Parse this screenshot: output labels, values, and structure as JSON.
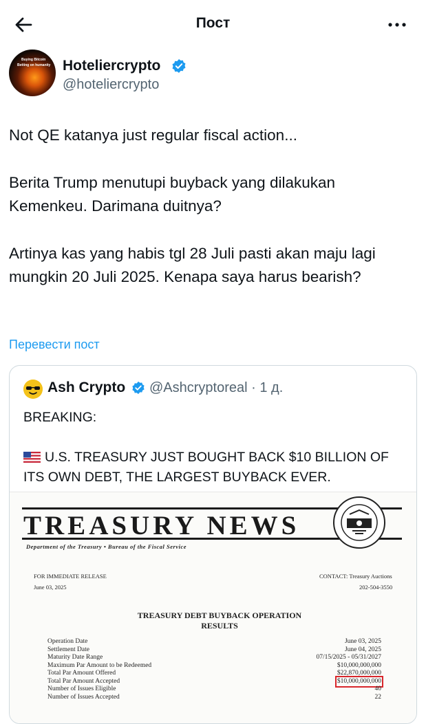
{
  "header": {
    "title": "Пост",
    "back_icon": "arrow-left-icon",
    "more_icon": "more-horizontal-icon"
  },
  "author": {
    "name": "Hoteliercrypto",
    "handle": "@hoteliercrypto",
    "avatar_text_1": "Buying Bitcoin",
    "avatar_text_2": "Betting on humanity"
  },
  "post": {
    "paragraphs": [
      "Not QE katanya just regular fiscal action...",
      "Berita Trump menutupi buyback yang dilakukan Kemenkeu. Darimana duitnya?",
      "Artinya kas yang habis tgl 28 Juli pasti akan maju lagi mungkin 20 Juli 2025. Kenapa saya harus bearish?"
    ],
    "translate_label": "Перевести пост"
  },
  "quote": {
    "name": "Ash Crypto",
    "handle_time": "@Ashcryptoreal · 1 д.",
    "line1": "BREAKING:",
    "line2": "U.S. TREASURY JUST BOUGHT BACK $10 BILLION OF ITS OWN DEBT, THE LARGEST BUYBACK EVER.",
    "document": {
      "masthead": "TREASURY NEWS",
      "subtitle": "Department of the Treasury • Bureau of the Fiscal Service",
      "release": "FOR IMMEDIATE RELEASE",
      "date": "June 03, 2025",
      "contact": "CONTACT: Treasury Auctions",
      "phone": "202-504-3550",
      "heading_1": "TREASURY DEBT BUYBACK OPERATION",
      "heading_2": "RESULTS",
      "rows": [
        {
          "label": "Operation Date",
          "value": "June 03, 2025"
        },
        {
          "label": "Settlement Date",
          "value": "June 04, 2025"
        },
        {
          "label": "Maturity Date Range",
          "value": "07/15/2025 - 05/31/2027"
        },
        {
          "label": "Maximum Par Amount to be Redeemed",
          "value": "$10,000,000,000"
        },
        {
          "label": "Total Par Amount Offered",
          "value": "$22,870,000,000"
        },
        {
          "label": "Total Par Amount Accepted",
          "value": "$10,000,000,000"
        },
        {
          "label": "Number of Issues Eligible",
          "value": "40"
        },
        {
          "label": "Number of Issues Accepted",
          "value": "22"
        }
      ]
    }
  },
  "colors": {
    "link": "#1d9bf0",
    "verified": "#1d9bf0",
    "muted": "#536471",
    "highlight": "#d8262b"
  }
}
